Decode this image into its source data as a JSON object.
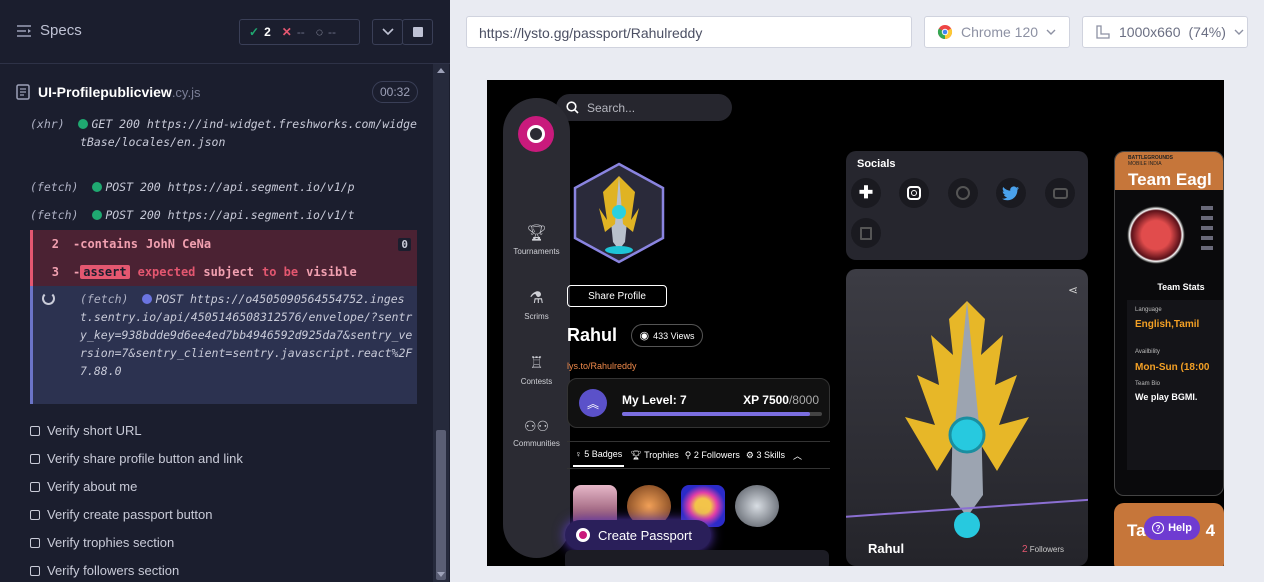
{
  "runner": {
    "specs_label": "Specs",
    "stats": {
      "passed": "2",
      "failed": "--",
      "pending": "--"
    },
    "spec_name": "UI-Profilepublicview",
    "spec_ext": ".cy.js",
    "timer": "00:32",
    "log": [
      {
        "type": "(xhr)",
        "method": "GET 200",
        "url": "https://ind-widget.freshworks.com/widgetBase/locales/en.json"
      },
      {
        "type": "(fetch)",
        "method": "POST 200",
        "url": "https://api.segment.io/v1/p"
      },
      {
        "type": "(fetch)",
        "method": "POST 200",
        "url": "https://api.segment.io/v1/t"
      }
    ],
    "errors": [
      {
        "num": "2",
        "cmd": "-contains",
        "text": "JohN CeNa",
        "badge": "0"
      },
      {
        "num": "3",
        "cmd": "-",
        "assert": "assert",
        "w1": "expected",
        "w2": "subject",
        "w3": "to be",
        "w4": "visible"
      }
    ],
    "pending": {
      "type": "(fetch)",
      "method": "POST",
      "url": "https://o4505090564554752.ingest.sentry.io/api/4505146508312576/envelope/?sentry_key=938bdde9d6ee4ed7bb4946592d925da7&sentry_version=7&sentry_client=sentry.javascript.react%2F7.88.0"
    },
    "tests": [
      "Verify short URL",
      "Verify share profile button and link",
      "Verify about me",
      "Verify create passport button",
      "Verify trophies section",
      "Verify followers section"
    ]
  },
  "browser": {
    "url": "https://lysto.gg/passport/Rahulreddy",
    "browser_name": "Chrome 120",
    "viewport": "1000x660",
    "zoom": "(74%)"
  },
  "app": {
    "search_placeholder": "Search...",
    "nav": [
      "Tournaments",
      "Scrims",
      "Contests",
      "Communities"
    ],
    "share_profile": "Share Profile",
    "name": "Rahul",
    "views": "433 Views",
    "short_url": "lys.to/Rahulreddy",
    "level_label": "My Level: 7",
    "xp_label": "XP",
    "xp_current": "7500",
    "xp_total": "/8000",
    "xp_fraction": 0.94,
    "tabs": [
      "5 Badges",
      "Trophies",
      "2 Followers",
      "3 Skills"
    ],
    "socials_title": "Socials",
    "card_name": "Rahul",
    "followers_count": "2",
    "followers_label": "Followers",
    "team": {
      "title": "Team Eagl",
      "banner_top": "BATTLEGROUNDS",
      "banner_sub": "MOBILE INDIA",
      "stats_title": "Team Stats",
      "language_label": "Language",
      "language": "English,Tamil",
      "availability_label": "Availbility",
      "availability": "Mon-Sun (18:00",
      "bio_label": "Team Bio",
      "bio": "We play BGMI."
    },
    "team2_title": "Ta",
    "team2_suffix": "4",
    "help_label": "Help",
    "create_passport": "Create Passport"
  }
}
